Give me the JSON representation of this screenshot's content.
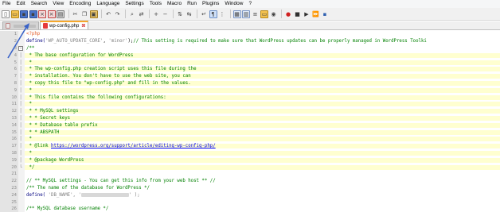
{
  "menu": [
    "File",
    "Edit",
    "Search",
    "View",
    "Encoding",
    "Language",
    "Settings",
    "Tools",
    "Macro",
    "Run",
    "Plugins",
    "Window",
    "?"
  ],
  "toolbar_icons": [
    {
      "name": "new-file-icon",
      "glyph": "▯",
      "color": "#ffffff",
      "border": "#909090"
    },
    {
      "name": "open-file-icon",
      "glyph": "▭",
      "color": "#f2c14e",
      "border": "#b88a1a"
    },
    {
      "name": "save-icon",
      "glyph": "▪",
      "color": "#4a74c9",
      "border": "#2d4f94"
    },
    {
      "name": "save-all-icon",
      "glyph": "▪",
      "color": "#4a74c9",
      "border": "#2d4f94"
    },
    {
      "name": "close-icon",
      "glyph": "×",
      "color": "#f3d7d7",
      "border": "#c04040"
    },
    {
      "name": "close-all-icon",
      "glyph": "×",
      "color": "#f3d7d7",
      "border": "#c04040"
    },
    {
      "name": "print-icon",
      "glyph": "▤",
      "color": "#d9d9d9",
      "border": "#7a7a7a"
    },
    {
      "sep": true
    },
    {
      "name": "cut-icon",
      "glyph": "✂",
      "color": "#f0f0f0",
      "border": "#f0f0f0"
    },
    {
      "name": "copy-icon",
      "glyph": "❐",
      "color": "#f0f0f0",
      "border": "#f0f0f0"
    },
    {
      "name": "paste-icon",
      "glyph": "▣",
      "color": "#e9c46a",
      "border": "#a07a20"
    },
    {
      "sep": true
    },
    {
      "name": "undo-icon",
      "glyph": "↶",
      "color": "#f0f0f0",
      "border": "#f0f0f0"
    },
    {
      "name": "redo-icon",
      "glyph": "↷",
      "color": "#f0f0f0",
      "border": "#f0f0f0"
    },
    {
      "sep": true
    },
    {
      "name": "find-icon",
      "glyph": "⌕",
      "color": "#f0f0f0",
      "border": "#f0f0f0"
    },
    {
      "name": "replace-icon",
      "glyph": "⇄",
      "color": "#f0f0f0",
      "border": "#f0f0f0"
    },
    {
      "sep": true
    },
    {
      "name": "zoom-in-icon",
      "glyph": "+",
      "color": "#f0f0f0",
      "border": "#f0f0f0"
    },
    {
      "name": "zoom-out-icon",
      "glyph": "−",
      "color": "#f0f0f0",
      "border": "#f0f0f0"
    },
    {
      "sep": true
    },
    {
      "name": "sync-vertical-icon",
      "glyph": "⇅",
      "color": "#f0f0f0",
      "border": "#f0f0f0"
    },
    {
      "name": "sync-horizontal-icon",
      "glyph": "⇆",
      "color": "#f0f0f0",
      "border": "#f0f0f0"
    },
    {
      "sep": true
    },
    {
      "name": "word-wrap-icon",
      "glyph": "↵",
      "color": "#f0f0f0",
      "border": "#f0f0f0"
    },
    {
      "name": "show-all-chars-icon",
      "glyph": "¶",
      "color": "#cfe0f7",
      "border": "#6b8fc7"
    },
    {
      "name": "indent-guide-icon",
      "glyph": "⋮",
      "color": "#f0f0f0",
      "border": "#f0f0f0"
    },
    {
      "sep": true
    },
    {
      "name": "udl-icon",
      "glyph": "▦",
      "color": "#dfe9f7",
      "border": "#7893c2"
    },
    {
      "name": "doc-map-icon",
      "glyph": "▥",
      "color": "#dfe9f7",
      "border": "#7893c2"
    },
    {
      "name": "function-list-icon",
      "glyph": "≡",
      "color": "#f0f0f0",
      "border": "#f0f0f0"
    },
    {
      "name": "folder-workspace-icon",
      "glyph": "▭",
      "color": "#f2c14e",
      "border": "#b88a1a"
    },
    {
      "name": "monitoring-icon",
      "glyph": "◉",
      "color": "#f0f0f0",
      "border": "#f0f0f0"
    },
    {
      "sep": true
    },
    {
      "name": "record-macro-icon",
      "glyph": "●",
      "color": "#f0f0f0",
      "border": "#f0f0f0",
      "fg": "#d02020"
    },
    {
      "name": "stop-macro-icon",
      "glyph": "■",
      "color": "#f0f0f0",
      "border": "#f0f0f0",
      "fg": "#303030"
    },
    {
      "name": "play-macro-icon",
      "glyph": "▶",
      "color": "#f0f0f0",
      "border": "#f0f0f0",
      "fg": "#303030"
    },
    {
      "name": "play-multiple-icon",
      "glyph": "⏩",
      "color": "#f0f0f0",
      "border": "#f0f0f0",
      "fg": "#303030"
    },
    {
      "name": "save-macro-icon",
      "glyph": "▪",
      "color": "#f0f0f0",
      "border": "#f0f0f0",
      "fg": "#3060b0"
    }
  ],
  "tabs": [
    {
      "label": "",
      "active": false,
      "blurred": true
    },
    {
      "label": "wp-config.php",
      "active": true,
      "blurred": false
    }
  ],
  "editor": {
    "lines": [
      {
        "n": "1",
        "fold": "",
        "segments": [
          {
            "t": "<?php",
            "c": "c-php"
          }
        ],
        "hl": false
      },
      {
        "n": "2",
        "fold": "",
        "segments": [
          {
            "t": "define(",
            "c": "c-func"
          },
          {
            "t": "'WP_AUTO_UPDATE_CORE'",
            "c": "c-str"
          },
          {
            "t": ", ",
            "c": ""
          },
          {
            "t": "'minor'",
            "c": "c-str"
          },
          {
            "t": ");",
            "c": ""
          },
          {
            "t": "// This setting is required to make sure that WordPress updates can be properly managed in WordPress Toolki",
            "c": "c-comment"
          }
        ],
        "hl": false
      },
      {
        "n": "3",
        "fold": "box",
        "segments": [
          {
            "t": "/**",
            "c": "c-comment"
          }
        ],
        "hl": false
      },
      {
        "n": "4",
        "fold": "",
        "segments": [
          {
            "t": " * The base configuration for WordPress",
            "c": "c-comment"
          }
        ],
        "hl": true
      },
      {
        "n": "5",
        "fold": "",
        "segments": [
          {
            "t": " *",
            "c": "c-comment"
          }
        ],
        "hl": true
      },
      {
        "n": "6",
        "fold": "",
        "segments": [
          {
            "t": " * The wp-config.php creation script uses this file during the",
            "c": "c-comment"
          }
        ],
        "hl": true
      },
      {
        "n": "7",
        "fold": "",
        "segments": [
          {
            "t": " * installation. You don't have to use the web site, you can",
            "c": "c-comment"
          }
        ],
        "hl": true
      },
      {
        "n": "8",
        "fold": "",
        "segments": [
          {
            "t": " * copy this file to \"wp-config.php\" and fill in the values.",
            "c": "c-comment"
          }
        ],
        "hl": true
      },
      {
        "n": "9",
        "fold": "",
        "segments": [
          {
            "t": " *",
            "c": "c-comment"
          }
        ],
        "hl": true
      },
      {
        "n": "10",
        "fold": "",
        "segments": [
          {
            "t": " * This file contains the following configurations:",
            "c": "c-comment"
          }
        ],
        "hl": true
      },
      {
        "n": "11",
        "fold": "",
        "segments": [
          {
            "t": " *",
            "c": "c-comment"
          }
        ],
        "hl": true
      },
      {
        "n": "12",
        "fold": "",
        "segments": [
          {
            "t": " * * MySQL settings",
            "c": "c-comment"
          }
        ],
        "hl": true
      },
      {
        "n": "13",
        "fold": "",
        "segments": [
          {
            "t": " * * Secret keys",
            "c": "c-comment"
          }
        ],
        "hl": true
      },
      {
        "n": "14",
        "fold": "",
        "segments": [
          {
            "t": " * * Database table prefix",
            "c": "c-comment"
          }
        ],
        "hl": true
      },
      {
        "n": "15",
        "fold": "",
        "segments": [
          {
            "t": " * * ABSPATH",
            "c": "c-comment"
          }
        ],
        "hl": true
      },
      {
        "n": "16",
        "fold": "",
        "segments": [
          {
            "t": " *",
            "c": "c-comment"
          }
        ],
        "hl": true
      },
      {
        "n": "17",
        "fold": "",
        "segments": [
          {
            "t": " * @link ",
            "c": "c-comment"
          },
          {
            "t": "https://wordpress.org/support/article/editing-wp-config-php/",
            "c": "c-link"
          }
        ],
        "hl": true
      },
      {
        "n": "18",
        "fold": "",
        "segments": [
          {
            "t": " *",
            "c": "c-comment"
          }
        ],
        "hl": true
      },
      {
        "n": "19",
        "fold": "",
        "segments": [
          {
            "t": " * @package WordPress",
            "c": "c-comment"
          }
        ],
        "hl": true
      },
      {
        "n": "20",
        "fold": "end",
        "segments": [
          {
            "t": " */",
            "c": "c-comment"
          }
        ],
        "hl": true
      },
      {
        "n": "21",
        "fold": "",
        "segments": [],
        "hl": false
      },
      {
        "n": "22",
        "fold": "",
        "segments": [
          {
            "t": "// ** MySQL settings - You can get this info from your web host ** //",
            "c": "c-comment"
          }
        ],
        "hl": false
      },
      {
        "n": "23",
        "fold": "",
        "segments": [
          {
            "t": "/** The name of the database for WordPress */",
            "c": "c-comment"
          }
        ],
        "hl": false
      },
      {
        "n": "24",
        "fold": "",
        "segments": [
          {
            "t": "define(",
            "c": "c-func"
          },
          {
            "t": " 'DB_NAME', '",
            "c": "c-str"
          },
          {
            "t": "",
            "c": "c-blur"
          },
          {
            "t": "' );",
            "c": "c-str"
          }
        ],
        "hl": false
      },
      {
        "n": "25",
        "fold": "",
        "segments": [],
        "hl": false
      },
      {
        "n": "26",
        "fold": "",
        "segments": [
          {
            "t": "/** MySQL database username */",
            "c": "c-comment"
          }
        ],
        "hl": false
      }
    ]
  },
  "colors": {
    "annotation": "#3a63c8",
    "tab_accent": "#f6a72b",
    "highlight": "#ffffd0"
  }
}
